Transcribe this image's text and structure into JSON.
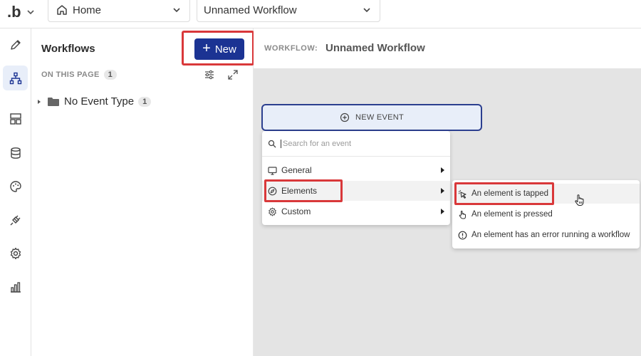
{
  "topbar": {
    "logo": ".b",
    "page_select": "Home",
    "workflow_select": "Unnamed Workflow"
  },
  "rail": {
    "icons": [
      "pencil-icon",
      "workflow-icon",
      "layout-icon",
      "database-icon",
      "palette-icon",
      "plug-icon",
      "gear-icon",
      "analytics-icon"
    ],
    "active": "workflow-icon"
  },
  "panel": {
    "title": "Workflows",
    "new_label": "New",
    "section_label": "ON THIS PAGE",
    "section_count": "1",
    "tree": [
      {
        "label": "No Event Type",
        "count": "1"
      }
    ]
  },
  "canvas": {
    "workflow_label": "WORKFLOW:",
    "workflow_name": "Unnamed Workflow",
    "new_event_label": "NEW EVENT",
    "background": "#e4e4e4"
  },
  "event_menu": {
    "search_placeholder": "Search for an event",
    "items": [
      {
        "label": "General",
        "icon": "monitor-icon"
      },
      {
        "label": "Elements",
        "icon": "compass-icon"
      },
      {
        "label": "Custom",
        "icon": "gear-icon"
      }
    ],
    "submenu": [
      {
        "label": "An element is tapped",
        "icon": "tap-cursor-icon"
      },
      {
        "label": "An element is pressed",
        "icon": "hand-pointer-icon"
      },
      {
        "label": "An element has an error running a workflow",
        "icon": "alert-circle-icon"
      }
    ]
  },
  "colors": {
    "accent": "#1b3393",
    "highlight": "#d9383a"
  }
}
